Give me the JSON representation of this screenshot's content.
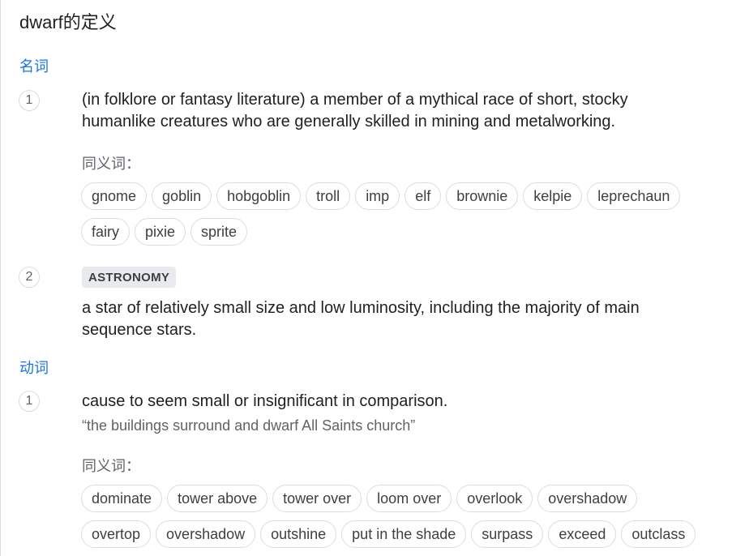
{
  "header": {
    "title": "dwarf的定义"
  },
  "noun": {
    "label": "名词",
    "senses": [
      {
        "number": "1",
        "definition": "(in folklore or fantasy literature) a member of a mythical race of short, stocky humanlike creatures who are generally skilled in mining and metalworking.",
        "synonyms_label": "同义词：",
        "synonyms_row1": [
          "gnome",
          "goblin",
          "hobgoblin",
          "troll",
          "imp",
          "elf",
          "brownie",
          "kelpie",
          "leprechaun"
        ],
        "synonyms_row2": [
          "fairy",
          "pixie",
          "sprite"
        ]
      },
      {
        "number": "2",
        "domain_tag": "ASTRONOMY",
        "definition": "a star of relatively small size and low luminosity, including the majority of main sequence stars."
      }
    ]
  },
  "verb": {
    "label": "动词",
    "senses": [
      {
        "number": "1",
        "definition": "cause to seem small or insignificant in comparison.",
        "example": "“the buildings surround and dwarf All Saints church”",
        "synonyms_label": "同义词：",
        "synonyms_row1": [
          "dominate",
          "tower above",
          "tower over",
          "loom over",
          "overlook",
          "overshadow"
        ],
        "synonyms_row2": [
          "overtop",
          "overshadow",
          "outshine",
          "put in the shade",
          "surpass",
          "exceed",
          "outclass"
        ]
      }
    ]
  }
}
